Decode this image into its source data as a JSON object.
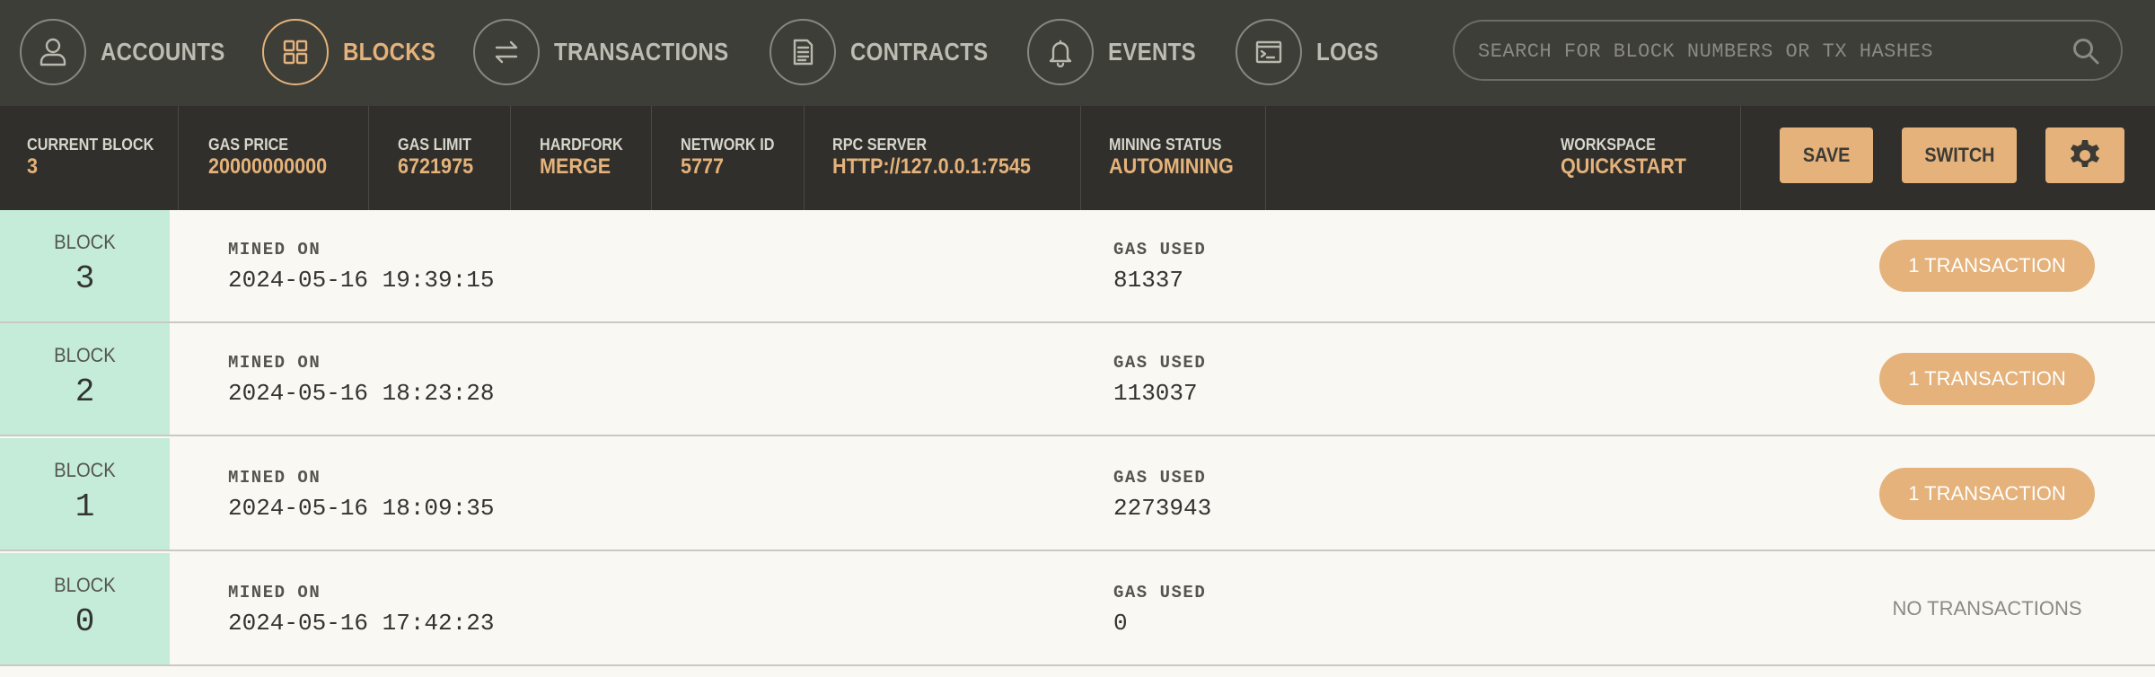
{
  "nav": {
    "items": [
      {
        "label": "ACCOUNTS",
        "icon": "person-icon",
        "active": false
      },
      {
        "label": "BLOCKS",
        "icon": "grid-icon",
        "active": true
      },
      {
        "label": "TRANSACTIONS",
        "icon": "transfer-arrows-icon",
        "active": false
      },
      {
        "label": "CONTRACTS",
        "icon": "document-icon",
        "active": false
      },
      {
        "label": "EVENTS",
        "icon": "bell-icon",
        "active": false
      },
      {
        "label": "LOGS",
        "icon": "terminal-window-icon",
        "active": false
      }
    ],
    "search": {
      "placeholder": "SEARCH FOR BLOCK NUMBERS OR TX HASHES",
      "value": "",
      "icon": "search-icon"
    }
  },
  "status": {
    "current_block": {
      "label": "CURRENT BLOCK",
      "value": "3"
    },
    "gas_price": {
      "label": "GAS PRICE",
      "value": "20000000000"
    },
    "gas_limit": {
      "label": "GAS LIMIT",
      "value": "6721975"
    },
    "hardfork": {
      "label": "HARDFORK",
      "value": "MERGE"
    },
    "network_id": {
      "label": "NETWORK ID",
      "value": "5777"
    },
    "rpc_server": {
      "label": "RPC SERVER",
      "value": "HTTP://127.0.0.1:7545"
    },
    "mining_status": {
      "label": "MINING STATUS",
      "value": "AUTOMINING"
    },
    "workspace": {
      "label": "WORKSPACE",
      "value": "QUICKSTART"
    },
    "save_label": "SAVE",
    "switch_label": "SWITCH",
    "settings_icon": "gear-icon"
  },
  "blocks": {
    "block_label": "BLOCK",
    "mined_label": "MINED ON",
    "gas_label": "GAS USED",
    "rows": [
      {
        "number": "3",
        "mined_on": "2024-05-16 19:39:15",
        "gas_used": "81337",
        "tx": "1 TRANSACTION",
        "has_tx": true
      },
      {
        "number": "2",
        "mined_on": "2024-05-16 18:23:28",
        "gas_used": "113037",
        "tx": "1 TRANSACTION",
        "has_tx": true
      },
      {
        "number": "1",
        "mined_on": "2024-05-16 18:09:35",
        "gas_used": "2273943",
        "tx": "1 TRANSACTION",
        "has_tx": true
      },
      {
        "number": "0",
        "mined_on": "2024-05-16 17:42:23",
        "gas_used": "0",
        "tx": "NO TRANSACTIONS",
        "has_tx": false
      }
    ]
  },
  "colors": {
    "nav_bg": "#3e3e39",
    "status_bg": "#302f2b",
    "accent": "#e4b27a",
    "block_cell_bg": "#c4ecd9",
    "list_bg": "#faf8f3"
  }
}
